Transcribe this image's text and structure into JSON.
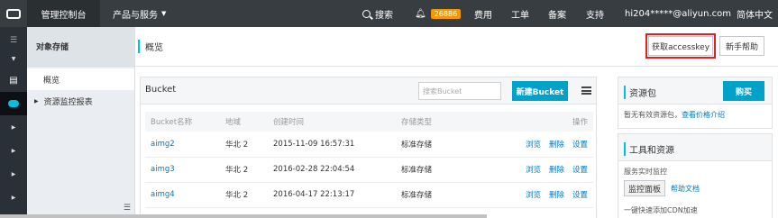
{
  "topbar": {
    "console": "管理控制台",
    "products": "产品与服务",
    "search": "搜索",
    "badge": "26886",
    "billing": "费用",
    "tickets": "工单",
    "record": "备案",
    "support": "支持",
    "user": "hi204*****@aliyun.com",
    "language": "简体中文"
  },
  "sidebar": {
    "title": "对象存储",
    "items": [
      {
        "label": "概览"
      },
      {
        "label": "资源监控报表"
      }
    ]
  },
  "header": {
    "title": "概览",
    "get_accesskey": "获取accesskey",
    "help": "新手帮助"
  },
  "bucket_panel": {
    "title": "Bucket",
    "search_placeholder": "搜索Bucket",
    "new_button": "新建Bucket",
    "columns": [
      "Bucket名称",
      "地域",
      "创建时间",
      "存储类型",
      "操作"
    ],
    "rows": [
      {
        "name": "aimg2",
        "region": "华北 2",
        "created": "2015-11-09 16:57:31",
        "type": "标准存储",
        "ops": [
          "浏览",
          "删除",
          "设置"
        ]
      },
      {
        "name": "aimg3",
        "region": "华北 2",
        "created": "2016-02-28 22:04:54",
        "type": "标准存储",
        "ops": [
          "浏览",
          "删除",
          "设置"
        ]
      },
      {
        "name": "aimg4",
        "region": "华北 2",
        "created": "2016-04-17 22:13:17",
        "type": "标准存储",
        "ops": [
          "浏览",
          "删除",
          "设置"
        ]
      }
    ]
  },
  "resource_panel": {
    "title": "资源包",
    "buy": "购买",
    "empty_text": "暂无有效资源包，",
    "price_link": "查看价格介绍"
  },
  "tools_panel": {
    "title": "工具和资源",
    "monitor_label": "服务实时监控",
    "monitor_button": "监控面板",
    "help_doc": "帮助文档",
    "cdn_text": "一键快速添加CDN加速"
  },
  "colors": {
    "accent": "#00c1de",
    "primary_button": "#00a2ca",
    "badge": "#f39800",
    "link": "#0077c8",
    "highlight": "#e02020"
  }
}
